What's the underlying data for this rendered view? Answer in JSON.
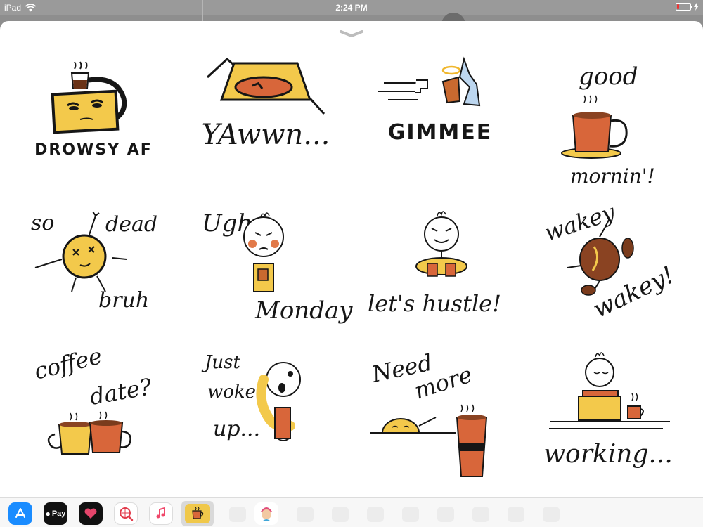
{
  "status_bar": {
    "device": "iPad",
    "time": "2:24 PM"
  },
  "stickers": [
    {
      "name": "drowsy-af",
      "text": [
        "DROWSY AF"
      ]
    },
    {
      "name": "yawwn",
      "text": [
        "YAwwn..."
      ]
    },
    {
      "name": "gimmee",
      "text": [
        "GIMMEE"
      ]
    },
    {
      "name": "good-mornin",
      "text": [
        "good",
        "mornin'!"
      ]
    },
    {
      "name": "so-dead-bruh",
      "text": [
        "so",
        "dead",
        "bruh"
      ]
    },
    {
      "name": "ugh-monday",
      "text": [
        "Ugh",
        "Monday"
      ]
    },
    {
      "name": "lets-hustle",
      "text": [
        "let's hustle!"
      ]
    },
    {
      "name": "wakey-wakey",
      "text": [
        "wakey",
        "wakey!"
      ]
    },
    {
      "name": "coffee-date",
      "text": [
        "coffee",
        "date?"
      ]
    },
    {
      "name": "just-woke-up",
      "text": [
        "Just",
        "woke",
        "up..."
      ]
    },
    {
      "name": "need-more",
      "text": [
        "Need",
        "more"
      ]
    },
    {
      "name": "working",
      "text": [
        "working..."
      ]
    }
  ],
  "drawer": {
    "apps": [
      {
        "name": "app-store",
        "label": "",
        "color": "#1a8cff"
      },
      {
        "name": "apple-pay",
        "label": "Pay",
        "color": "#111111"
      },
      {
        "name": "digital-touch",
        "label": "",
        "color": "#111111"
      },
      {
        "name": "search-images",
        "label": "",
        "color": "#ffffff"
      },
      {
        "name": "music",
        "label": "",
        "color": "#ffffff"
      },
      {
        "name": "coffee-stickers",
        "label": "",
        "color": "#f0c84a"
      },
      {
        "name": "avatar-stickers",
        "label": "",
        "color": "#ffffff"
      }
    ]
  },
  "colors": {
    "accent_yellow": "#f3c94b",
    "coffee_orange": "#d8663a",
    "coffee_brown": "#7a3b1c",
    "ink": "#161616"
  }
}
